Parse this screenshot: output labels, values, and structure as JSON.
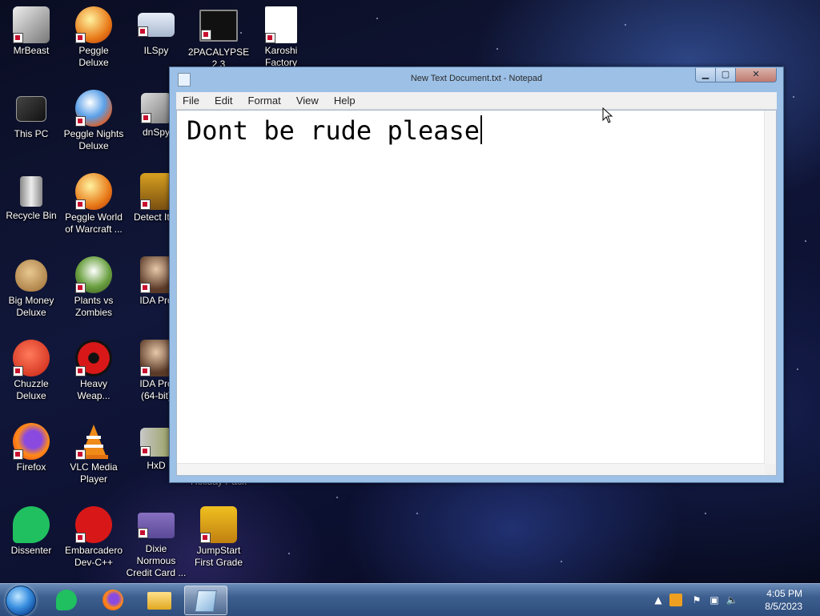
{
  "desktop": {
    "icons": [
      {
        "label": "MrBeast"
      },
      {
        "label": "Peggle Deluxe"
      },
      {
        "label": "ILSpy"
      },
      {
        "label": "2PACALYPSE\n2.3"
      },
      {
        "label": "Karoshi\nFactory"
      },
      {
        "label": "This PC"
      },
      {
        "label": "Peggle Nights\nDeluxe"
      },
      {
        "label": "dnSpy"
      },
      {
        "label": "Recycle Bin"
      },
      {
        "label": "Peggle World\nof Warcraft ..."
      },
      {
        "label": "Detect It E"
      },
      {
        "label": "Big Money\nDeluxe"
      },
      {
        "label": "Plants vs\nZombies"
      },
      {
        "label": "IDA Pro"
      },
      {
        "label": "Chuzzle\nDeluxe"
      },
      {
        "label": "Heavy\nWeap..."
      },
      {
        "label": "IDA Pro\n(64-bit)"
      },
      {
        "label": "Firefox"
      },
      {
        "label": "VLC Media\nPlayer"
      },
      {
        "label": "HxD"
      },
      {
        "label": "Holiday Pack"
      },
      {
        "label": "Dissenter"
      },
      {
        "label": "Embarcadero\nDev-C++"
      },
      {
        "label": "Dixie Normous\nCredit Card ..."
      },
      {
        "label": "JumpStart\nFirst Grade"
      }
    ]
  },
  "notepad": {
    "title": "New Text Document.txt - Notepad",
    "controls": {
      "minimize": "▁",
      "maximize": "▢",
      "close": "✕"
    },
    "menu": [
      "File",
      "Edit",
      "Format",
      "View",
      "Help"
    ],
    "content": "Dont be rude please"
  },
  "taskbar": {
    "clock_time": "4:05 PM",
    "clock_date": "8/5/2023",
    "tray_expand": "▲"
  },
  "colors": {
    "window_frame": "#9cc0e6",
    "taskbar": "#3d5f8f"
  }
}
